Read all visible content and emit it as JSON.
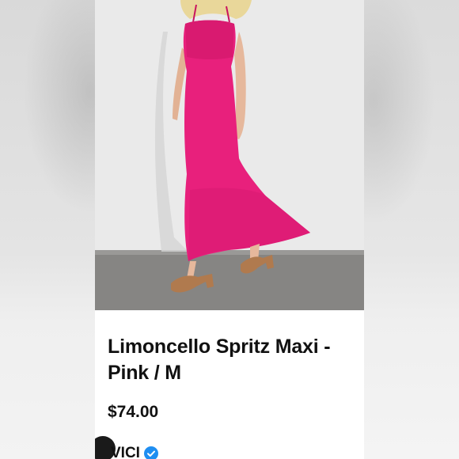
{
  "listing": {
    "title": "Limoncello Spritz Maxi - Pink / M",
    "price": "$74.00",
    "seller": {
      "name": "VICI",
      "verified_icon": "verified-check-icon",
      "avatar": "avatar"
    }
  },
  "photo": {
    "subject": "product-photo",
    "dress_color": "#e8207c"
  },
  "colors": {
    "text": "#111111",
    "verified_blue": "#1f8ef1",
    "background": "#ffffff"
  }
}
